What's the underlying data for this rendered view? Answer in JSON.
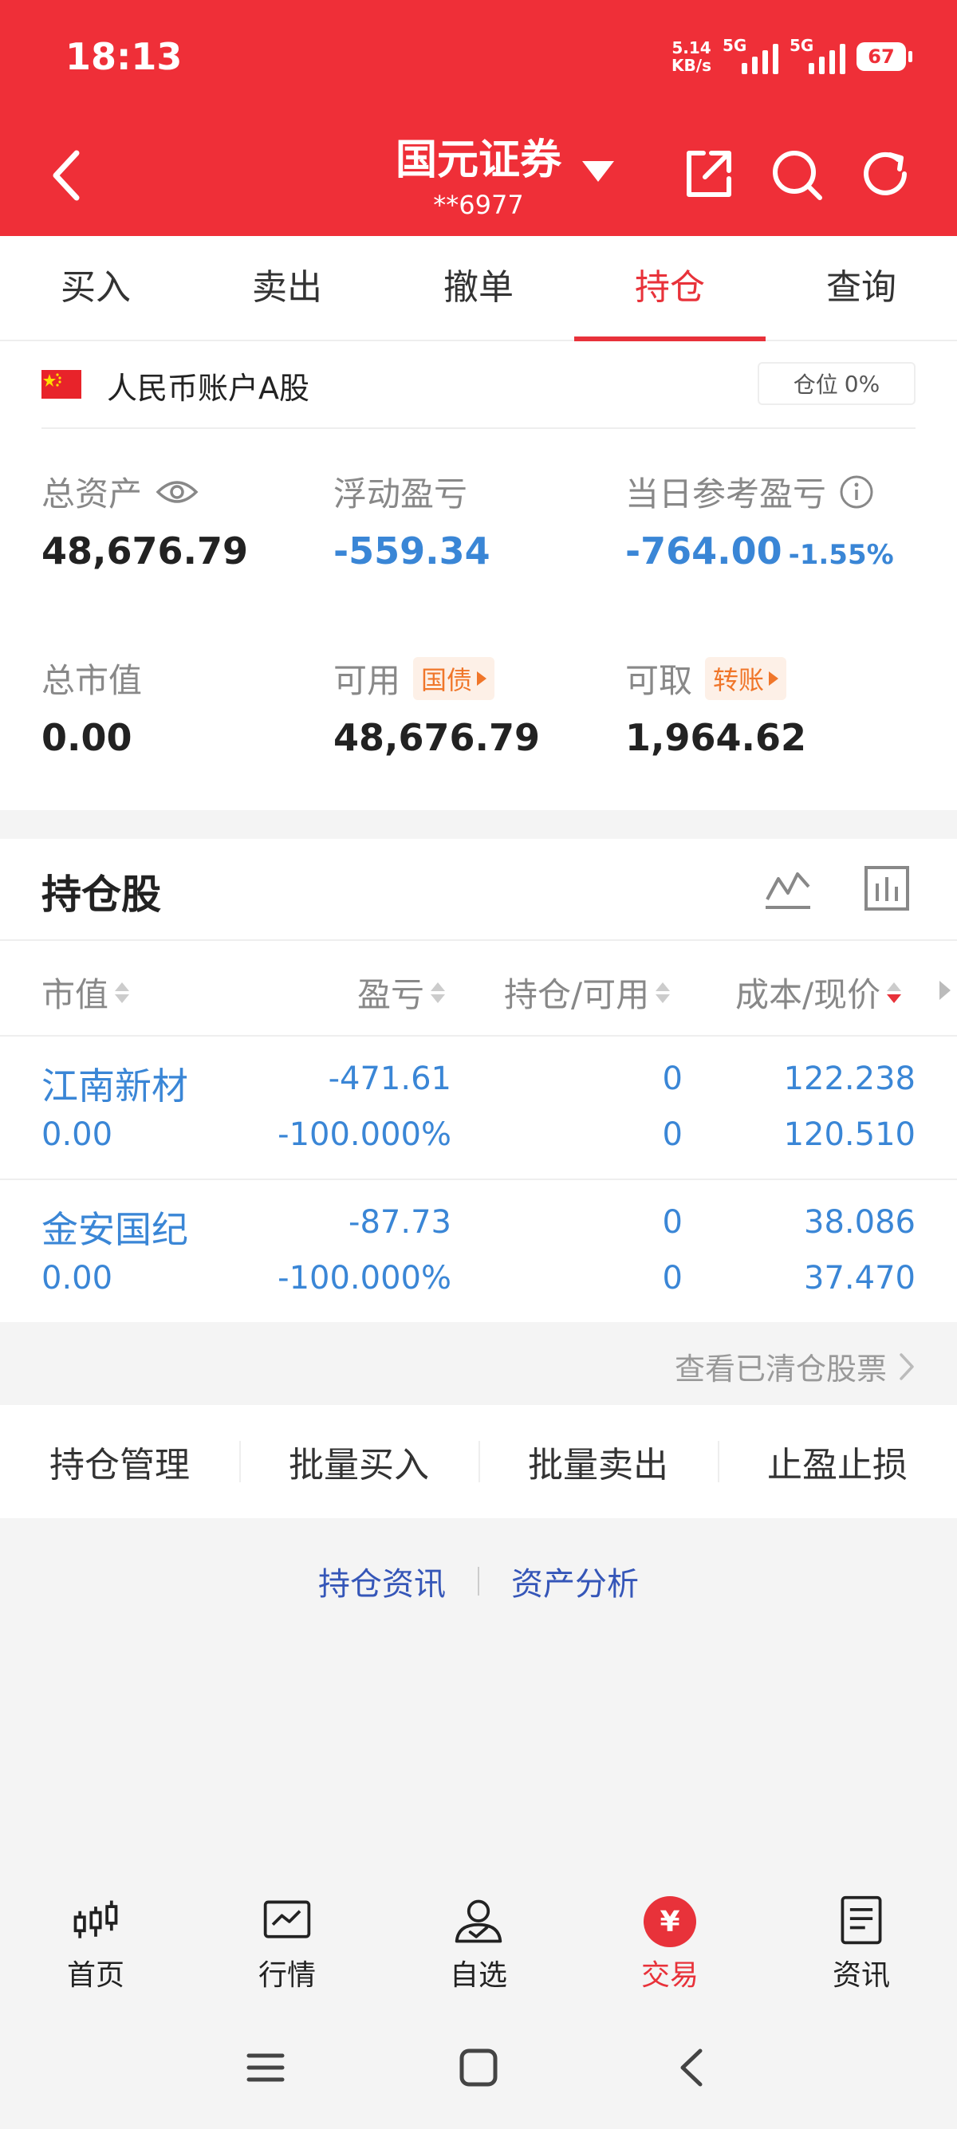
{
  "status_bar": {
    "time": "18:13",
    "net_speed_value": "5.14",
    "net_speed_unit": "KB/s",
    "signal_1": "5G",
    "signal_2": "5G",
    "battery": "67"
  },
  "header": {
    "broker": "国元证券",
    "account": "**6977"
  },
  "tabs": [
    {
      "label": "买入"
    },
    {
      "label": "卖出"
    },
    {
      "label": "撤单"
    },
    {
      "label": "持仓",
      "active": true
    },
    {
      "label": "查询"
    }
  ],
  "account_panel": {
    "account_name": "人民币账户A股",
    "position_label": "仓位",
    "position_value": "0%",
    "total_assets": {
      "label": "总资产",
      "value": "48,676.79"
    },
    "floating_pl": {
      "label": "浮动盈亏",
      "value": "-559.34"
    },
    "daily_pl": {
      "label": "当日参考盈亏",
      "value": "-764.00",
      "pct": "-1.55%"
    },
    "market_value": {
      "label": "总市值",
      "value": "0.00"
    },
    "available": {
      "label": "可用",
      "tag": "国债",
      "value": "48,676.79"
    },
    "withdrawable": {
      "label": "可取",
      "tag": "转账",
      "value": "1,964.62"
    }
  },
  "holdings": {
    "title": "持仓股",
    "columns": [
      "市值",
      "盈亏",
      "持仓/可用",
      "成本/现价"
    ],
    "rows": [
      {
        "name": "江南新材",
        "market_value": "0.00",
        "pl": "-471.61",
        "pl_pct": "-100.000%",
        "hold": "0",
        "avail": "0",
        "cost": "122.238",
        "price": "120.510"
      },
      {
        "name": "金安国纪",
        "market_value": "0.00",
        "pl": "-87.73",
        "pl_pct": "-100.000%",
        "hold": "0",
        "avail": "0",
        "cost": "38.086",
        "price": "37.470"
      }
    ],
    "cleared_link": "查看已清仓股票"
  },
  "actions": [
    "持仓管理",
    "批量买入",
    "批量卖出",
    "止盈止损"
  ],
  "links": [
    "持仓资讯",
    "资产分析"
  ],
  "bottom_nav": [
    {
      "label": "首页",
      "icon": "candlestick-icon"
    },
    {
      "label": "行情",
      "icon": "chart-icon"
    },
    {
      "label": "自选",
      "icon": "user-icon"
    },
    {
      "label": "交易",
      "icon": "yen-icon",
      "symbol": "¥",
      "active": true
    },
    {
      "label": "资讯",
      "icon": "document-icon"
    }
  ],
  "colors": {
    "brand_red": "#ef2f38",
    "loss_blue": "#3a86d6",
    "tag_orange": "#f0762a"
  }
}
